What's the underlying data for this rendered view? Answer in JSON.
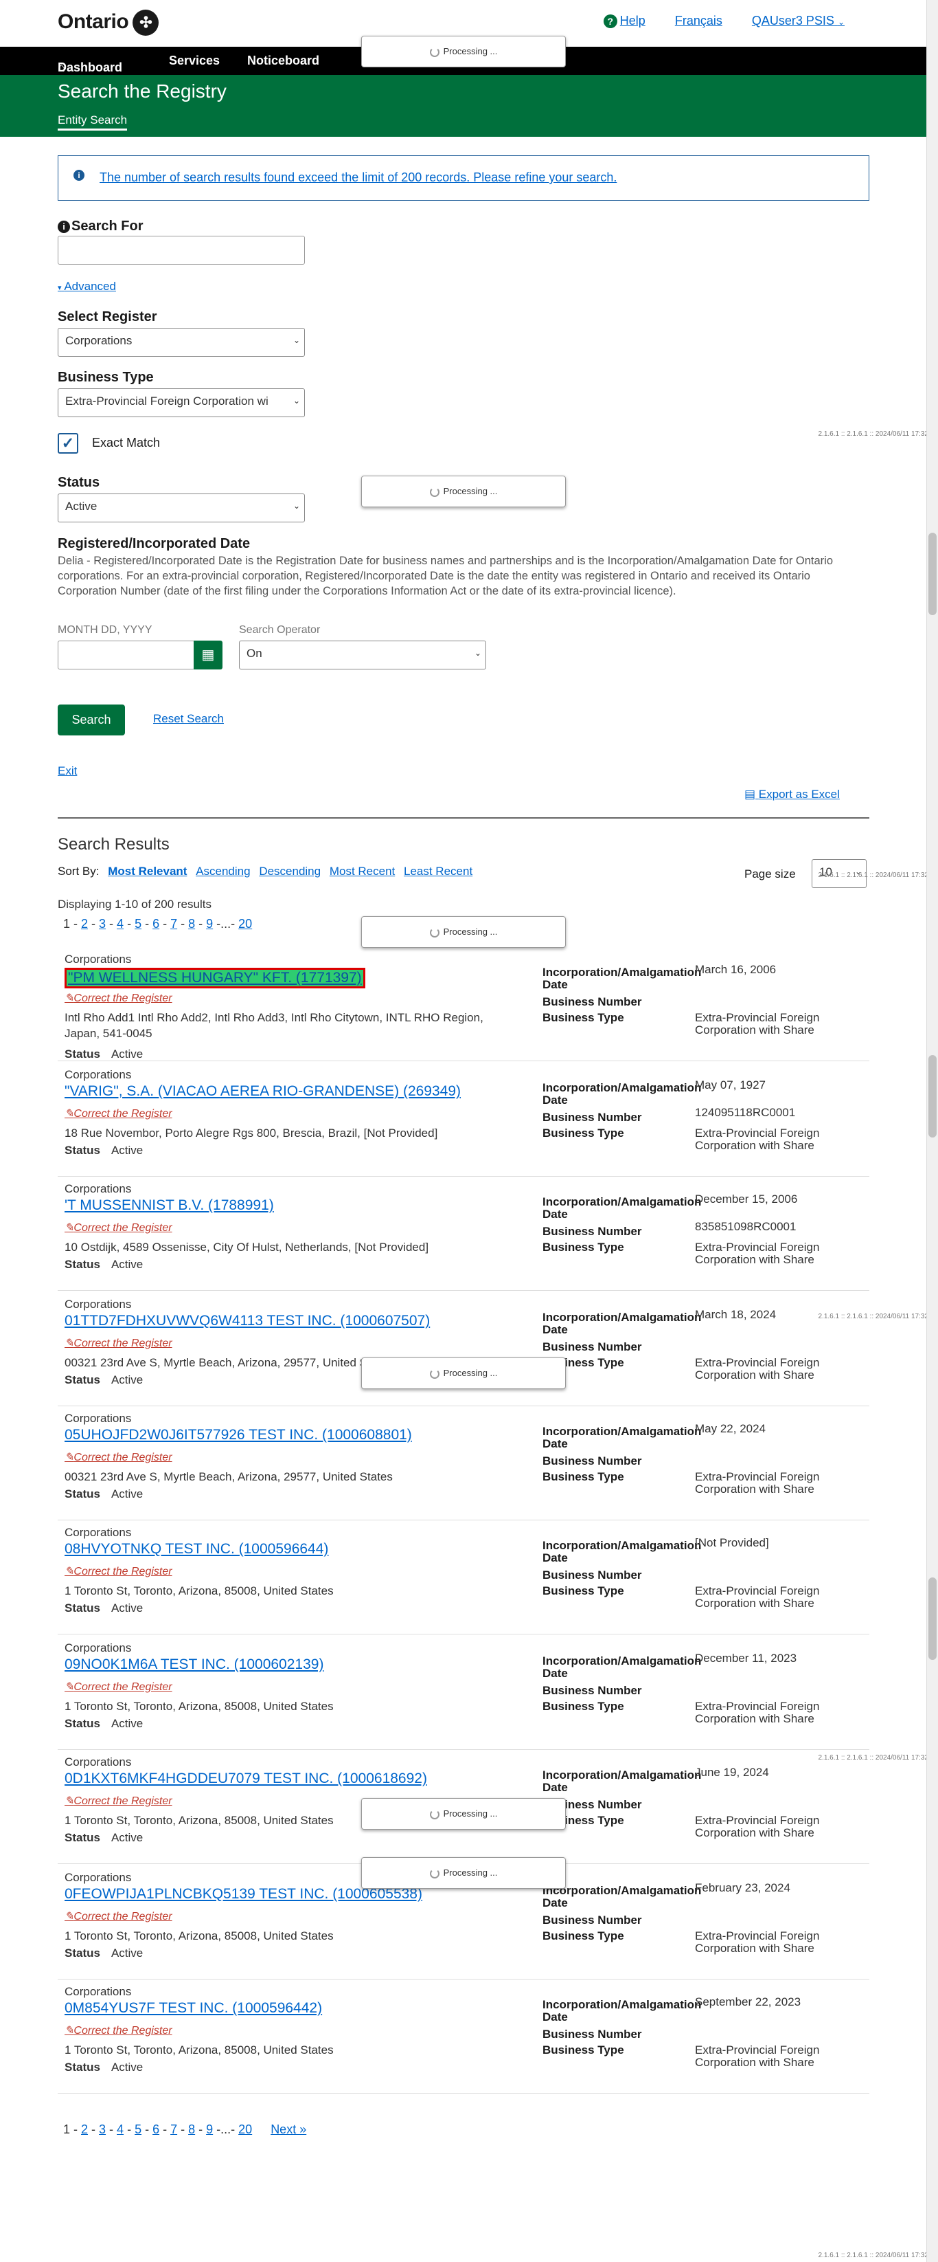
{
  "header": {
    "logo_text": "Ontario",
    "help": "Help",
    "francais": "Français",
    "user": "QAUser3 PSIS"
  },
  "nav": [
    "Dashboard",
    "Services",
    "Noticeboard"
  ],
  "banner": {
    "title": "Search the Registry",
    "subtab": "Entity Search"
  },
  "alert": "The number of search results found exceed the limit of 200 records. Please refine your search.",
  "form": {
    "search_for_label": "Search For",
    "search_for_value": "",
    "advanced_label": "Advanced",
    "register_label": "Select Register",
    "register_value": "Corporations",
    "business_type_label": "Business Type",
    "business_type_value": "Extra-Provincial Foreign Corporation wi",
    "exact_match_label": "Exact Match",
    "exact_match_checked": true,
    "status_label": "Status",
    "status_value": "Active",
    "reg_date_label": "Registered/Incorporated Date",
    "reg_date_desc": "Delia - Registered/Incorporated Date is the Registration Date for business names and partnerships and is the Incorporation/Amalgamation Date for Ontario corporations. For an extra-provincial corporation, Registered/Incorporated Date is the date the entity was registered in Ontario and received its Ontario Corporation Number (date of the first filing under the Corporations Information Act or the date of its extra-provincial licence).",
    "date_placeholder_label": "MONTH DD, YYYY",
    "operator_label": "Search Operator",
    "operator_value": "On",
    "search_button": "Search",
    "reset_link": "Reset Search",
    "exit_link": "Exit",
    "export_label": "Export as Excel"
  },
  "processing_text": "Processing ...",
  "version_text": "2.1.6.1 :: 2.1.6.1 :: 2024/06/11 17:32",
  "results": {
    "title": "Search Results",
    "sort_label": "Sort By:",
    "sort_options": [
      "Most Relevant",
      "Ascending",
      "Descending",
      "Most Recent",
      "Least Recent"
    ],
    "page_size_label": "Page size",
    "page_size_value": "10",
    "displaying": "Displaying 1-10 of 200 results",
    "pages": [
      "1",
      "2",
      "3",
      "4",
      "5",
      "6",
      "7",
      "8",
      "9",
      "20"
    ],
    "next": "Next »",
    "field_labels": {
      "inc_date": "Incorporation/Amalgamation Date",
      "bn": "Business Number",
      "type": "Business Type",
      "status": "Status",
      "correct": "Correct the Register"
    },
    "items": [
      {
        "category": "Corporations",
        "name": "\"PM WELLNESS HUNGARY\" KFT. (1771397)",
        "address": "Intl Rho Add1 Intl Rho Add2, Intl Rho Add3, Intl Rho Citytown, INTL RHO Region, Japan, 541-0045",
        "status": "Active",
        "inc_date": "March 16, 2006",
        "bn": "",
        "type": "Extra-Provincial Foreign Corporation with Share"
      },
      {
        "category": "Corporations",
        "name": "\"VARIG\", S.A. (VIACAO AEREA RIO-GRANDENSE) (269349)",
        "address": "18 Rue Novembor, Porto Alegre Rgs 800, Brescia, Brazil, [Not Provided]",
        "status": "Active",
        "inc_date": "May 07, 1927",
        "bn": "124095118RC0001",
        "type": "Extra-Provincial Foreign Corporation with Share"
      },
      {
        "category": "Corporations",
        "name": "'T MUSSENNIST B.V. (1788991)",
        "address": "10 Ostdijk, 4589 Ossenisse, City Of Hulst, Netherlands, [Not Provided]",
        "status": "Active",
        "inc_date": "December 15, 2006",
        "bn": "835851098RC0001",
        "type": "Extra-Provincial Foreign Corporation with Share"
      },
      {
        "category": "Corporations",
        "name": "01TTD7FDHXUVWVQ6W4113 TEST INC. (1000607507)",
        "address": "00321 23rd Ave S, Myrtle Beach, Arizona, 29577, United States",
        "status": "Active",
        "inc_date": "March 18, 2024",
        "bn": "",
        "type": "Extra-Provincial Foreign Corporation with Share"
      },
      {
        "category": "Corporations",
        "name": "05UHOJFD2W0J6IT577926 TEST INC. (1000608801)",
        "address": "00321 23rd Ave S, Myrtle Beach, Arizona, 29577, United States",
        "status": "Active",
        "inc_date": "May 22, 2024",
        "bn": "",
        "type": "Extra-Provincial Foreign Corporation with Share"
      },
      {
        "category": "Corporations",
        "name": "08HVYOTNKQ TEST INC. (1000596644)",
        "address": "1 Toronto St, Toronto, Arizona, 85008, United States",
        "status": "Active",
        "inc_date": "[Not Provided]",
        "bn": "",
        "type": "Extra-Provincial Foreign Corporation with Share"
      },
      {
        "category": "Corporations",
        "name": "09NO0K1M6A TEST INC. (1000602139)",
        "address": "1 Toronto St, Toronto, Arizona, 85008, United States",
        "status": "Active",
        "inc_date": "December 11, 2023",
        "bn": "",
        "type": "Extra-Provincial Foreign Corporation with Share"
      },
      {
        "category": "Corporations",
        "name": "0D1KXT6MKF4HGDDEU7079 TEST INC. (1000618692)",
        "address": "1 Toronto St, Toronto, Arizona, 85008, United States",
        "status": "Active",
        "inc_date": "June 19, 2024",
        "bn": "",
        "type": "Extra-Provincial Foreign Corporation with Share"
      },
      {
        "category": "Corporations",
        "name": "0FEOWPIJA1PLNCBKQ5139 TEST INC. (1000605538)",
        "address": "1 Toronto St, Toronto, Arizona, 85008, United States",
        "status": "Active",
        "inc_date": "February 23, 2024",
        "bn": "",
        "type": "Extra-Provincial Foreign Corporation with Share"
      },
      {
        "category": "Corporations",
        "name": "0M854YUS7F TEST INC. (1000596442)",
        "address": "1 Toronto St, Toronto, Arizona, 85008, United States",
        "status": "Active",
        "inc_date": "September 22, 2023",
        "bn": "",
        "type": "Extra-Provincial Foreign Corporation with Share"
      }
    ]
  }
}
